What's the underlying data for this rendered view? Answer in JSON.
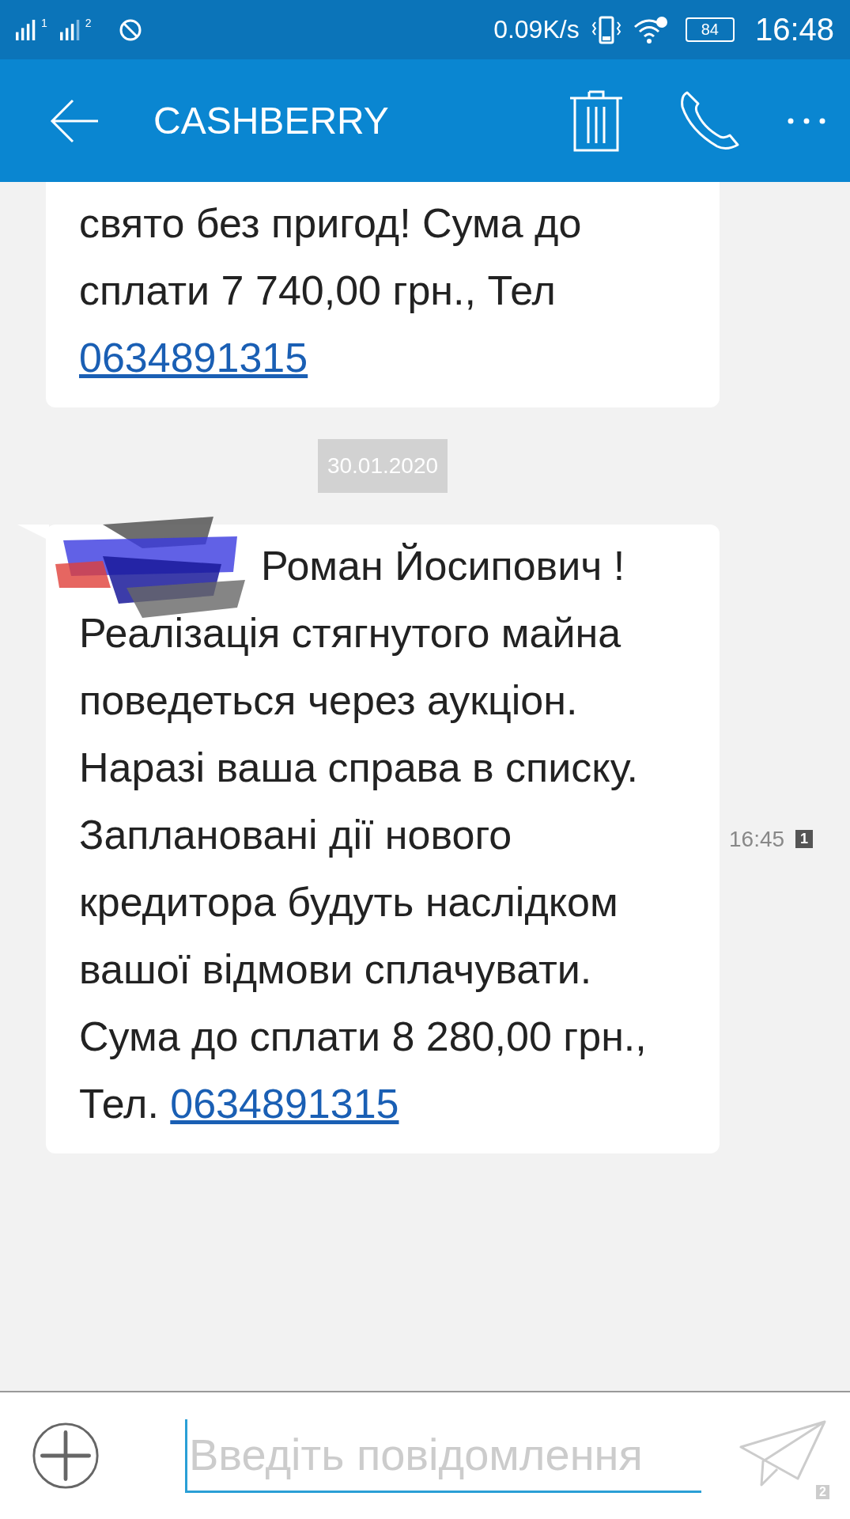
{
  "status_bar": {
    "sim_labels": [
      "1",
      "2"
    ],
    "net_speed": "0.09K/s",
    "battery": "84",
    "time": "16:48"
  },
  "header": {
    "title": "CASHBERRY"
  },
  "items": [
    {
      "kind": "message",
      "redacted": false,
      "text": "свято без пригод!  Сума до сплати 7 740,00 грн., Тел",
      "phone": "0634891315"
    },
    {
      "kind": "date",
      "text": "30.01.2020"
    },
    {
      "kind": "message",
      "redacted": true,
      "text": "Роман Йосипович ! Реалізація стягнутого майна поведеться через аукціон. Наразі ваша справа в списку. Заплановані дії нового кредитора будуть наслідком вашої відмови сплачувати. Сума до сплати 8 280,00 грн., Тел.",
      "phone": "0634891315",
      "time": "16:45",
      "sim": "1"
    }
  ],
  "composer": {
    "placeholder": "Введіть повідомлення",
    "send_sim": "2"
  }
}
